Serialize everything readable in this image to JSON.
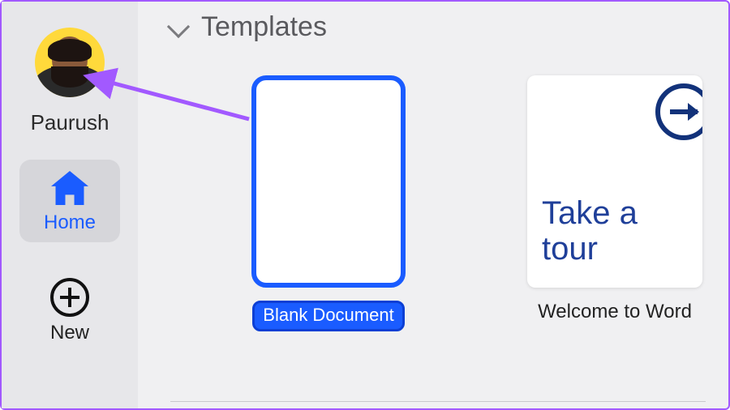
{
  "sidebar": {
    "user_name": "Paurush",
    "nav_home_label": "Home",
    "nav_new_label": "New"
  },
  "main": {
    "section_title": "Templates",
    "templates": [
      {
        "label": "Blank Document",
        "selected": true
      },
      {
        "label": "Welcome to Word",
        "preview_text": "Take a tour"
      }
    ]
  },
  "colors": {
    "accent": "#1a5cff",
    "annotation": "#a259ff"
  }
}
